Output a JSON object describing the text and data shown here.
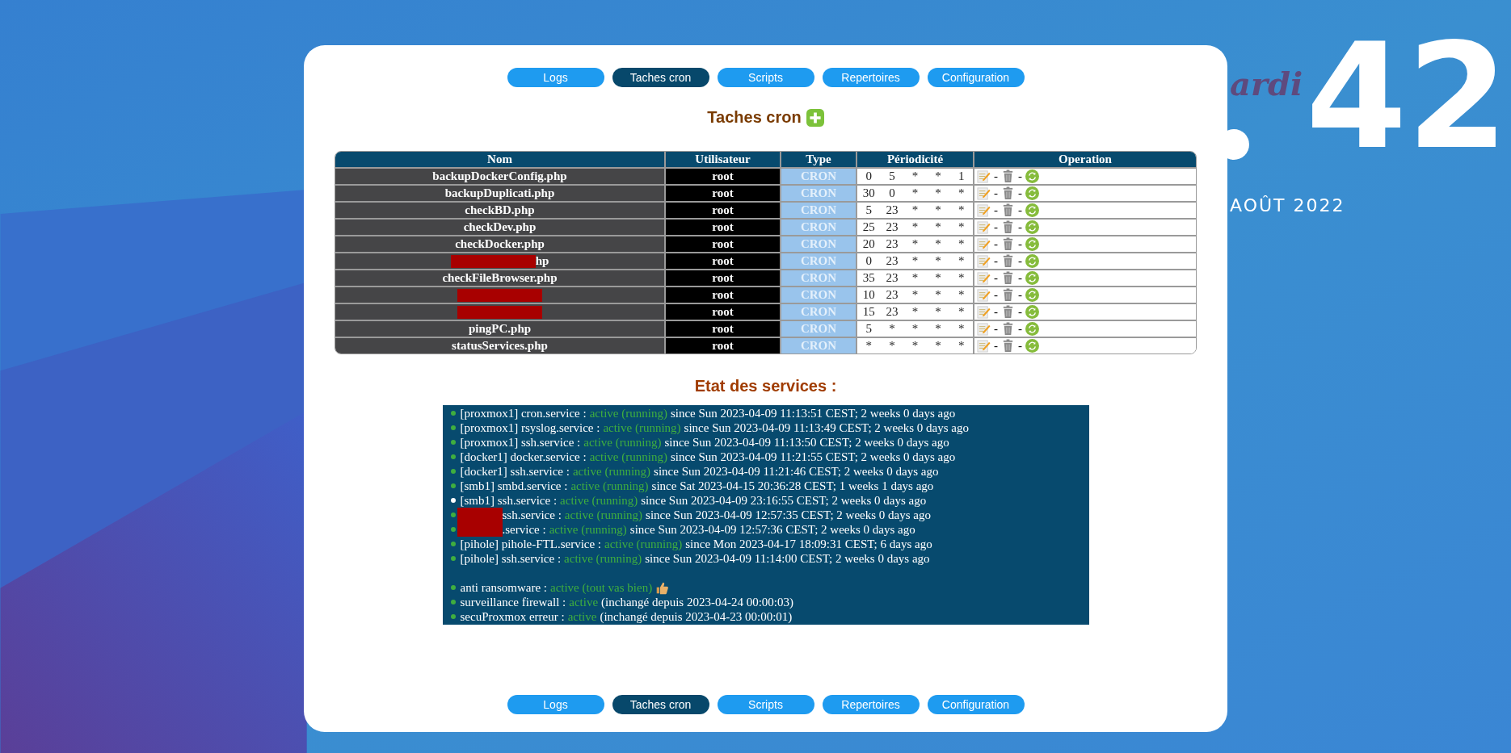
{
  "desktop": {
    "clock_minutes": "42",
    "day_fragment": "ardi",
    "date_fragment": "AOÛT 2022"
  },
  "nav_top": [
    {
      "label": "Logs",
      "selected": false
    },
    {
      "label": "Taches cron",
      "selected": true
    },
    {
      "label": "Scripts",
      "selected": false
    },
    {
      "label": "Repertoires",
      "selected": false
    },
    {
      "label": "Configuration",
      "selected": false
    }
  ],
  "cron": {
    "title": "Taches cron",
    "columns": [
      "Nom",
      "Utilisateur",
      "Type",
      "Périodicité",
      "Operation"
    ],
    "separators": [
      "-",
      "-"
    ],
    "rows": [
      {
        "name": "backupDockerConfig.php",
        "redacted": false,
        "user": "root",
        "type": "CRON",
        "schedule": [
          "0",
          "5",
          "*",
          "*",
          "1"
        ]
      },
      {
        "name": "backupDuplicati.php",
        "redacted": false,
        "user": "root",
        "type": "CRON",
        "schedule": [
          "30",
          "0",
          "*",
          "*",
          "*"
        ]
      },
      {
        "name": "checkBD.php",
        "redacted": false,
        "user": "root",
        "type": "CRON",
        "schedule": [
          "5",
          "23",
          "*",
          "*",
          "*"
        ]
      },
      {
        "name": "checkDev.php",
        "redacted": false,
        "user": "root",
        "type": "CRON",
        "schedule": [
          "25",
          "23",
          "*",
          "*",
          "*"
        ]
      },
      {
        "name": "checkDocker.php",
        "redacted": false,
        "user": "root",
        "type": "CRON",
        "schedule": [
          "20",
          "23",
          "*",
          "*",
          "*"
        ]
      },
      {
        "name": "hp",
        "redacted": true,
        "user": "root",
        "type": "CRON",
        "schedule": [
          "0",
          "23",
          "*",
          "*",
          "*"
        ]
      },
      {
        "name": "checkFileBrowser.php",
        "redacted": false,
        "user": "root",
        "type": "CRON",
        "schedule": [
          "35",
          "23",
          "*",
          "*",
          "*"
        ]
      },
      {
        "redacted": true,
        "user": "root",
        "type": "CRON",
        "schedule": [
          "10",
          "23",
          "*",
          "*",
          "*"
        ]
      },
      {
        "redacted": true,
        "user": "root",
        "type": "CRON",
        "schedule": [
          "15",
          "23",
          "*",
          "*",
          "*"
        ]
      },
      {
        "name": "pingPC.php",
        "redacted": false,
        "user": "root",
        "type": "CRON",
        "schedule": [
          "5",
          "*",
          "*",
          "*",
          "*"
        ]
      },
      {
        "name": "statusServices.php",
        "redacted": false,
        "user": "root",
        "type": "CRON",
        "schedule": [
          "*",
          "*",
          "*",
          "*",
          "*"
        ]
      }
    ]
  },
  "services": {
    "title": "Etat des services :",
    "groups": [
      [
        {
          "label": "[proxmox1] cron.service :",
          "status": "active (running)",
          "detail": "since Sun 2023-04-09 11:13:51 CEST; 2 weeks 0 days ago",
          "color": "#3fae3f",
          "redacted": false
        },
        {
          "label": "[proxmox1] rsyslog.service :",
          "status": "active (running)",
          "detail": "since Sun 2023-04-09 11:13:49 CEST; 2 weeks 0 days ago",
          "color": "#3fae3f",
          "redacted": false
        },
        {
          "label": "[proxmox1] ssh.service :",
          "status": "active (running)",
          "detail": "since Sun 2023-04-09 11:13:50 CEST; 2 weeks 0 days ago",
          "color": "#3fae3f",
          "redacted": false
        },
        {
          "label": "[docker1] docker.service :",
          "status": "active (running)",
          "detail": "since Sun 2023-04-09 11:21:55 CEST; 2 weeks 0 days ago",
          "color": "#3fae3f",
          "redacted": false
        },
        {
          "label": "[docker1] ssh.service :",
          "status": "active (running)",
          "detail": "since Sun 2023-04-09 11:21:46 CEST; 2 weeks 0 days ago",
          "color": "#3fae3f",
          "redacted": false
        },
        {
          "label": "[smb1] smbd.service :",
          "status": "active (running)",
          "detail": "since Sat 2023-04-15 20:36:28 CEST; 1 weeks 1 days ago",
          "color": "#3fae3f",
          "redacted": false
        },
        {
          "label": "[smb1] ssh.service :",
          "status": "active (running)",
          "detail": "since Sun 2023-04-09 23:16:55 CEST; 2 weeks 0 days ago",
          "color": "#ffffff",
          "redacted": false
        },
        {
          "label": "ssh.service :",
          "status": "active (running)",
          "detail": "since Sun 2023-04-09 12:57:35 CEST; 2 weeks 0 days ago",
          "color": "#3fae3f",
          "redacted": true
        },
        {
          "label": ".service :",
          "status": "active (running)",
          "detail": "since Sun 2023-04-09 12:57:36 CEST; 2 weeks 0 days ago",
          "color": "#3fae3f",
          "redacted": true
        },
        {
          "label": "[pihole] pihole-FTL.service :",
          "status": "active (running)",
          "detail": "since Mon 2023-04-17 18:09:31 CEST; 6 days ago",
          "color": "#3fae3f",
          "redacted": false
        },
        {
          "label": "[pihole] ssh.service :",
          "status": "active (running)",
          "detail": "since Sun 2023-04-09 11:14:00 CEST; 2 weeks 0 days ago",
          "color": "#3fae3f",
          "redacted": false
        }
      ],
      [
        {
          "label": "anti ransomware :",
          "status": "active (tout vas bien)",
          "thumbs_up": true,
          "color": "#3fae3f",
          "redacted": false
        },
        {
          "label": "surveillance firewall :",
          "status": "active",
          "detail": "(inchangé depuis 2023-04-24 00:00:03)",
          "color": "#3fae3f",
          "redacted": false
        },
        {
          "label": "secuProxmox erreur :",
          "status": "active",
          "detail": "(inchangé depuis 2023-04-23 00:00:01)",
          "color": "#3fae3f",
          "redacted": false
        }
      ]
    ]
  },
  "nav_bottom": [
    {
      "label": "Logs",
      "selected": false
    },
    {
      "label": "Taches cron",
      "selected": true
    },
    {
      "label": "Scripts",
      "selected": false
    },
    {
      "label": "Repertoires",
      "selected": false
    },
    {
      "label": "Configuration",
      "selected": false
    }
  ]
}
